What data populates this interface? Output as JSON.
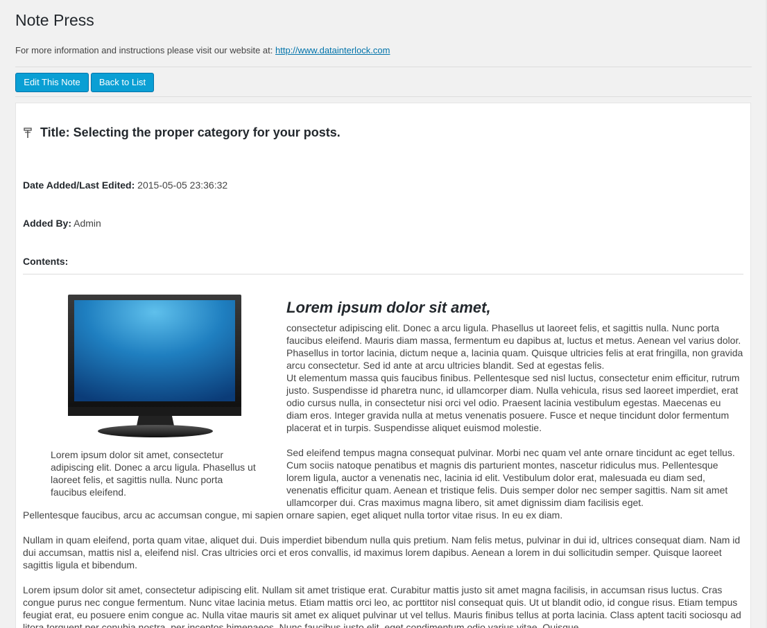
{
  "header": {
    "title": "Note Press",
    "info_text": "For more information and instructions please visit our website at: ",
    "info_link": "http://www.datainterlock.com"
  },
  "toolbar": {
    "edit_label": "Edit This Note",
    "back_label": "Back to List"
  },
  "note": {
    "title": "Title: Selecting the proper category for your posts.",
    "date_label": "Date Added/Last Edited:",
    "date_value": " 2015-05-05 23:36:32",
    "added_by_label": "Added By:",
    "added_by_value": " Admin",
    "contents_label": "Contents:"
  },
  "content": {
    "image_caption": "Lorem ipsum dolor sit amet, consectetur adipiscing elit. Donec a arcu ligula. Phasellus ut laoreet felis, et sagittis nulla. Nunc porta faucibus eleifend.",
    "heading": "Lorem ipsum dolor sit amet,",
    "p1a": "consectetur adipiscing elit. Donec a arcu ligula. Phasellus ut laoreet felis, et sagittis nulla. Nunc porta faucibus eleifend. Mauris diam massa, fermentum eu dapibus at, luctus et metus. Aenean vel varius dolor. Phasellus in tortor lacinia, dictum neque a, lacinia quam. Quisque ultricies felis at erat fringilla, non gravida arcu consectetur. Sed id ante at arcu ultricies blandit. Sed at egestas felis.",
    "p1b": "Ut elementum massa quis faucibus finibus. Pellentesque sed nisl luctus, consectetur enim efficitur, rutrum justo. Suspendisse id pharetra nunc, id ullamcorper diam. Nulla vehicula, risus sed laoreet imperdiet, erat odio cursus nulla, in consectetur nisi orci vel odio. Praesent lacinia vestibulum egestas. Maecenas eu diam eros. Integer gravida nulla at metus venenatis posuere. Fusce et neque tincidunt dolor fermentum placerat et in turpis. Suspendisse aliquet euismod molestie.",
    "p2": "Sed eleifend tempus magna consequat pulvinar. Morbi nec quam vel ante ornare tincidunt ac eget tellus. Cum sociis natoque penatibus et magnis dis parturient montes, nascetur ridiculus mus. Pellentesque lorem ligula, auctor a venenatis nec, lacinia id elit. Vestibulum dolor erat, malesuada eu diam sed, venenatis efficitur quam. Aenean et tristique felis. Duis semper dolor nec semper sagittis. Nam sit amet ullamcorper dui. Cras maximus magna libero, sit amet dignissim diam facilisis eget.",
    "p3": "Pellentesque faucibus, arcu ac accumsan congue, mi sapien ornare sapien, eget aliquet nulla tortor vitae risus. In eu ex diam.",
    "p4": "Nullam in quam eleifend, porta quam vitae, aliquet dui. Duis imperdiet bibendum nulla quis pretium. Nam felis metus, pulvinar in dui id, ultrices consequat diam. Nam id dui accumsan, mattis nisl a, eleifend nisl. Cras ultricies orci et eros convallis, id maximus lorem dapibus. Aenean a lorem in dui sollicitudin semper. Quisque laoreet sagittis ligula et bibendum.",
    "p5": "Lorem ipsum dolor sit amet, consectetur adipiscing elit. Nullam sit amet tristique erat. Curabitur mattis justo sit amet magna facilisis, in accumsan risus luctus. Cras congue purus nec congue fermentum. Nunc vitae lacinia metus. Etiam mattis orci leo, ac porttitor nisl consequat quis. Ut ut blandit odio, id congue risus. Etiam tempus feugiat erat, eu posuere enim congue ac. Nulla vitae mauris sit amet ex aliquet pulvinar ut vel tellus. Mauris finibus tellus at porta lacinia. Class aptent taciti sociosqu ad litora torquent per conubia nostra, per inceptos himenaeos. Nunc faucibus justo elit, eget condimentum odio varius vitae. Quisque"
  },
  "icons": {
    "title_icon": "pushpin-icon",
    "image": "monitor-icon"
  },
  "colors": {
    "button_bg": "#0a9fd4",
    "link": "#0073aa",
    "page_bg": "#f1f1f1"
  }
}
